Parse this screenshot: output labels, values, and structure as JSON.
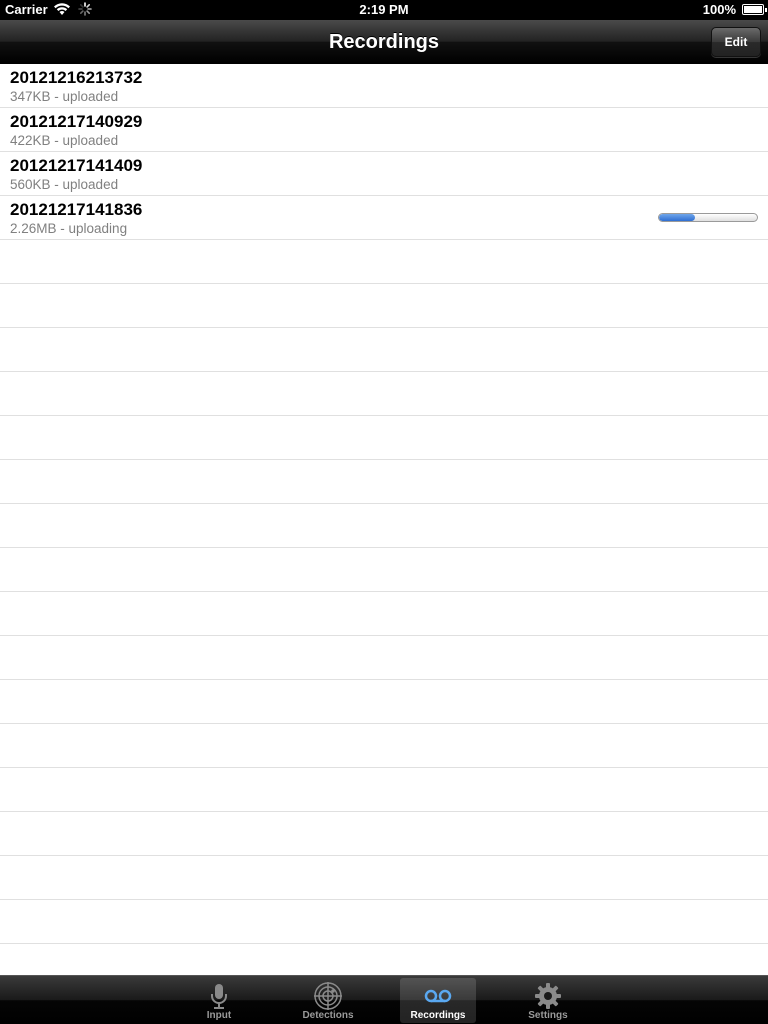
{
  "status_bar": {
    "carrier": "Carrier",
    "time": "2:19 PM",
    "battery": "100%"
  },
  "nav": {
    "title": "Recordings",
    "edit_label": "Edit"
  },
  "recordings": [
    {
      "name": "20121216213732",
      "detail": "347KB - uploaded"
    },
    {
      "name": "20121217140929",
      "detail": "422KB - uploaded"
    },
    {
      "name": "20121217141409",
      "detail": "560KB - uploaded"
    },
    {
      "name": "20121217141836",
      "detail": "2.26MB - uploading",
      "upload_progress": 0.37
    }
  ],
  "tabs": [
    {
      "label": "Input",
      "icon": "microphone-icon"
    },
    {
      "label": "Detections",
      "icon": "radar-icon"
    },
    {
      "label": "Recordings",
      "icon": "voicemail-icon",
      "selected": true
    },
    {
      "label": "Settings",
      "icon": "gear-icon"
    }
  ],
  "colors": {
    "progress_fill": "#3a7bd5",
    "tab_selected": "#5aa8f0"
  }
}
